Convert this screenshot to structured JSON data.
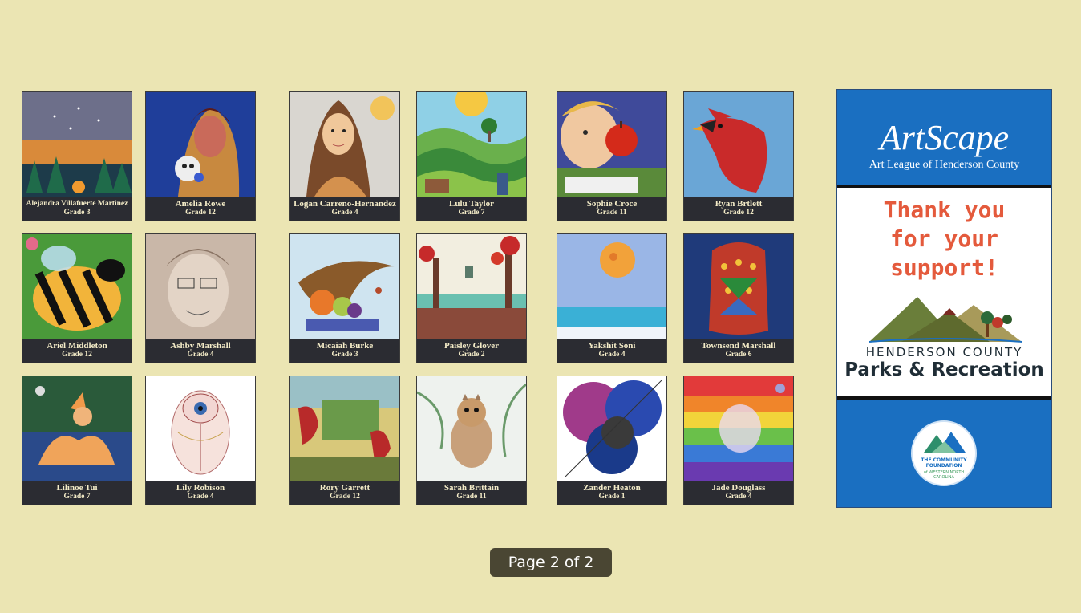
{
  "gallery": [
    {
      "name": "Alejandra Villafuerte Martinez",
      "grade": "Grade 3",
      "art": "night-sky-forest"
    },
    {
      "name": "Amelia Rowe",
      "grade": "Grade 12",
      "art": "portrait-skull"
    },
    {
      "name": "Logan Carreno-Hernandez",
      "grade": "Grade 4",
      "art": "mona-lisa"
    },
    {
      "name": "Lulu Taylor",
      "grade": "Grade 7",
      "art": "sun-landscape"
    },
    {
      "name": "Sophie Croce",
      "grade": "Grade 11",
      "art": "apple-portrait"
    },
    {
      "name": "Ryan Brtlett",
      "grade": "Grade 12",
      "art": "cardinal"
    },
    {
      "name": "Ariel Middleton",
      "grade": "Grade 12",
      "art": "bee"
    },
    {
      "name": "Ashby Marshall",
      "grade": "Grade 4",
      "art": "pencil-portrait"
    },
    {
      "name": "Micaiah Burke",
      "grade": "Grade 3",
      "art": "cornucopia"
    },
    {
      "name": "Paisley Glover",
      "grade": "Grade 2",
      "art": "autumn-trees"
    },
    {
      "name": "Yakshit Soni",
      "grade": "Grade 4",
      "art": "moon-sea"
    },
    {
      "name": "Townsend Marshall",
      "grade": "Grade 6",
      "art": "mosaic"
    },
    {
      "name": "Lilinoe Tui",
      "grade": "Grade 7",
      "art": "foxes"
    },
    {
      "name": "Lily Robison",
      "grade": "Grade 4",
      "art": "beetle"
    },
    {
      "name": "Rory Garrett",
      "grade": "Grade 12",
      "art": "cardinals-collage"
    },
    {
      "name": "Sarah Brittain",
      "grade": "Grade 11",
      "art": "chipmunk"
    },
    {
      "name": "Zander Heaton",
      "grade": "Grade 1",
      "art": "circles"
    },
    {
      "name": "Jade Douglass",
      "grade": "Grade 4",
      "art": "rainbow"
    }
  ],
  "sponsor": {
    "logo": "ArtScape",
    "subtitle": "Art League of Henderson County",
    "thanks_line1": "Thank you",
    "thanks_line2": "for your",
    "thanks_line3": "support!",
    "org_line1": "HENDERSON COUNTY",
    "org_line2": "Parks & Recreation",
    "badge_line1": "THE COMMUNITY",
    "badge_line2": "FOUNDATION",
    "badge_line3": "of WESTERN NORTH",
    "badge_line4": "CAROLINA"
  },
  "pager": {
    "label": "Page 2 of 2"
  },
  "colors": {
    "background": "#ebe5b3",
    "caption_bg": "#2b2c32",
    "caption_text": "#f4ecc8",
    "sponsor_blue": "#1a6fc1",
    "pager_bg": "#4a4633"
  }
}
